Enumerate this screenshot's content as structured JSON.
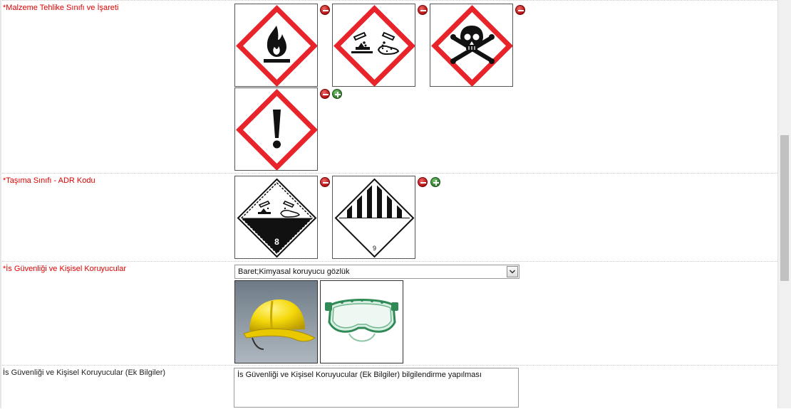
{
  "sections": {
    "hazard": {
      "label": "*Malzeme Tehlike Sınıfı ve İşareti",
      "pictograms": [
        "flame-pictogram",
        "corrosion-pictogram",
        "skull-crossbones-pictogram",
        "exclamation-pictogram"
      ]
    },
    "transport": {
      "label": "*Taşıma Sınıfı - ADR Kodu",
      "placards": [
        {
          "icon": "corrosive-class-8-placard",
          "number": "8"
        },
        {
          "icon": "misc-class-9-placard",
          "number": "9"
        }
      ]
    },
    "ppe": {
      "label": "*İs Güvenliği ve Kişisel Koruyucular",
      "selected": "Baret;Kimyasal koruyucu gözlük",
      "images": [
        "hard-hat-photo",
        "safety-goggles-photo"
      ]
    },
    "ppe_extra": {
      "label": "İs Güvenliği ve Kişisel Koruyucular (Ek Bilgiler)",
      "value": "İs Güvenliği ve Kişisel Koruyucular (Ek Bilgiler) bilgilendirme yapılması"
    }
  },
  "icons": {
    "remove": "minus-circle-icon",
    "add": "plus-circle-icon",
    "dropdown": "chevron-down-icon"
  },
  "colors": {
    "required_label": "#e00000",
    "hazard_red": "#e8232a",
    "remove_button": "#c41414",
    "add_button": "#3a8a33"
  }
}
